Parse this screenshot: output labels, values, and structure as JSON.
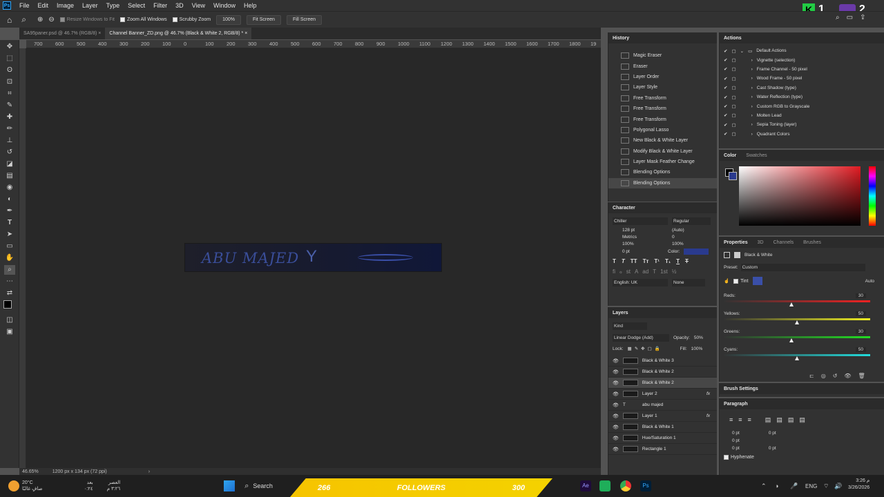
{
  "app": {
    "icon_label": "Ps"
  },
  "menu": [
    "File",
    "Edit",
    "Image",
    "Layer",
    "Type",
    "Select",
    "Filter",
    "3D",
    "View",
    "Window",
    "Help"
  ],
  "options_bar": {
    "resize_windows_label": "Resize Windows to Fit",
    "zoom_all_label": "Zoom All Windows",
    "scrubby_label": "Scrubby Zoom",
    "zoom_value": "100%",
    "fit_screen": "Fit Screen",
    "fill_screen": "Fill Screen"
  },
  "overlay": {
    "k_number": "1",
    "num2": "2"
  },
  "tabs": [
    {
      "label": "SA95paner.psd @ 46.7% (RGB/8)",
      "close": "×"
    },
    {
      "label": "Channel Banner_ZD.png @ 46.7% (Black & White 2, RGB/8) *",
      "close": "×"
    }
  ],
  "ruler_ticks": [
    "700",
    "600",
    "500",
    "400",
    "300",
    "200",
    "100",
    "0",
    "100",
    "200",
    "300",
    "400",
    "500",
    "600",
    "700",
    "800",
    "900",
    "1000",
    "1100",
    "1200",
    "1300",
    "1400",
    "1500",
    "1600",
    "1700",
    "1800",
    "19"
  ],
  "banner": {
    "text": "ABU MAJED"
  },
  "status": {
    "zoom": "46.65%",
    "doc": "1200 px x 134 px (72 ppi)"
  },
  "history": {
    "title": "History",
    "items": [
      "Magic Eraser",
      "Eraser",
      "Layer Order",
      "Layer Style",
      "Free Transform",
      "Free Transform",
      "Free Transform",
      "Polygonal Lasso",
      "New Black & White Layer",
      "Modify Black & White Layer",
      "Layer Mask Feather Change",
      "Blending Options",
      "Blending Options"
    ]
  },
  "actions": {
    "title": "Actions",
    "items": [
      "Default Actions",
      "Vignette (selection)",
      "Frame Channel - 50 pixel",
      "Wood Frame - 50 pixel",
      "Cast Shadow (type)",
      "Water Reflection (type)",
      "Custom RGB to Grayscale",
      "Molten Lead",
      "Sepia Toning (layer)",
      "Quadrant Colors"
    ]
  },
  "color": {
    "tab1": "Color",
    "tab2": "Swatches",
    "hue_color": "#e11b22"
  },
  "character": {
    "title": "Character",
    "font": "Chiller",
    "style": "Regular",
    "size": "128 pt",
    "leading": "(Auto)",
    "kerning": "Metrics",
    "tracking": "0",
    "vscale": "100%",
    "hscale": "100%",
    "baseline": "0 pt",
    "color_label": "Color:",
    "language": "English: UK",
    "aa": "None",
    "swatch": "#2a3a8e"
  },
  "layers": {
    "title": "Layers",
    "kind": "Kind",
    "blend": "Linear Dodge (Add)",
    "opacity_label": "Opacity:",
    "opacity": "50%",
    "lock_label": "Lock:",
    "fill_label": "Fill:",
    "fill": "100%",
    "items": [
      {
        "name": "Black & White 3",
        "fx": ""
      },
      {
        "name": "Black & White 2",
        "fx": ""
      },
      {
        "name": "Black & White 2",
        "fx": ""
      },
      {
        "name": "Layer 2",
        "fx": "fx"
      },
      {
        "name": "abu majed",
        "fx": ""
      },
      {
        "name": "Layer 1",
        "fx": "fx"
      },
      {
        "name": "Black & White 1",
        "fx": ""
      },
      {
        "name": "Hue/Saturation 1",
        "fx": ""
      },
      {
        "name": "Rectangle 1",
        "fx": ""
      }
    ]
  },
  "properties": {
    "tabs": [
      "Properties",
      "3D",
      "Channels",
      "Brushes"
    ],
    "layer_name": "Black & White",
    "preset_label": "Preset:",
    "preset": "Custom",
    "tint_label": "Tint",
    "auto": "Auto",
    "tint_color": "#3a4fa8",
    "sliders": [
      {
        "label": "Reds:",
        "value": "30",
        "level": 0.46,
        "grad": "linear-gradient(90deg,#333,#e22)"
      },
      {
        "label": "Yellows:",
        "value": "50",
        "level": 0.5,
        "grad": "linear-gradient(90deg,#333,#ee2)"
      },
      {
        "label": "Greens:",
        "value": "30",
        "level": 0.46,
        "grad": "linear-gradient(90deg,#333,#2d2)"
      },
      {
        "label": "Cyans:",
        "value": "50",
        "level": 0.5,
        "grad": "linear-gradient(90deg,#333,#2dd)"
      }
    ]
  },
  "brush_settings": {
    "title": "Brush Settings"
  },
  "paragraph": {
    "title": "Paragraph",
    "v1": "0 pt",
    "v2": "0 pt",
    "v3": "0 pt",
    "v4": "0 pt",
    "v5": "0 pt",
    "hyphenate": "Hyphenate"
  },
  "taskbar": {
    "weather_temp": "20°C",
    "weather_desc": "صافٍ غالبًا",
    "prayer_label": "العصر",
    "prayer_after": "بعد",
    "prayer_time": "٣:٢٦ م",
    "prayer_remaining": "٠:٢٤",
    "search": "Search",
    "followers_left": "266",
    "followers_label": "FOLLOWERS",
    "followers_right": "300",
    "lang": "ENG",
    "time": "3:26 م",
    "date": "3/26/2026"
  }
}
